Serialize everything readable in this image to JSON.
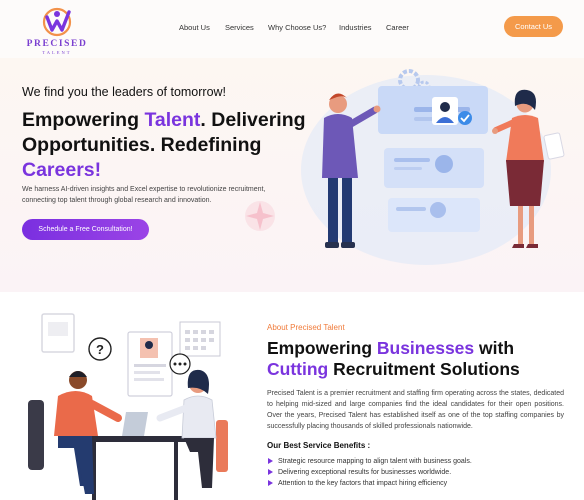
{
  "brand": {
    "name": "PRECISED",
    "tagline": "TALENT"
  },
  "nav": {
    "items": [
      "About Us",
      "Services",
      "Why Choose Us?",
      "Industries",
      "Career"
    ]
  },
  "header": {
    "contact_label": "Contact Us"
  },
  "hero": {
    "tagline": "We find you the leaders of tomorrow!",
    "title": {
      "p1": "Empowering ",
      "p2": "Talent",
      "p3": ". Delivering Opportunities. Redefining ",
      "p4": "Careers!"
    },
    "description": "We harness AI-driven insights and Excel expertise to revolutionize recruitment, connecting top talent through global research and innovation.",
    "cta_label": "Schedule a Free Consultation!"
  },
  "about": {
    "tag": "About Precised Talent",
    "title": {
      "p1": "Empowering ",
      "p2": "Businesses",
      "p3": " with ",
      "p4": "Cutting",
      "p5": " Recruitment Solutions"
    },
    "description": "Precised Talent is a premier recruitment and staffing firm operating across the states, dedicated to helping mid-sized and large companies find the ideal candidates for their open positions. Over the years, Precised Talent has established itself as one of the top staffing companies by successfully placing thousands of skilled professionals nationwide.",
    "benefits_title": "Our Best Service Benefits :",
    "benefits": [
      "Strategic resource mapping to align talent with business goals.",
      "Delivering exceptional results for businesses worldwide.",
      "Attention to the key factors that impact hiring efficiency"
    ]
  },
  "colors": {
    "accent": "#7a34de",
    "orange": "#f49a4a",
    "about_tag": "#f07b3a"
  }
}
